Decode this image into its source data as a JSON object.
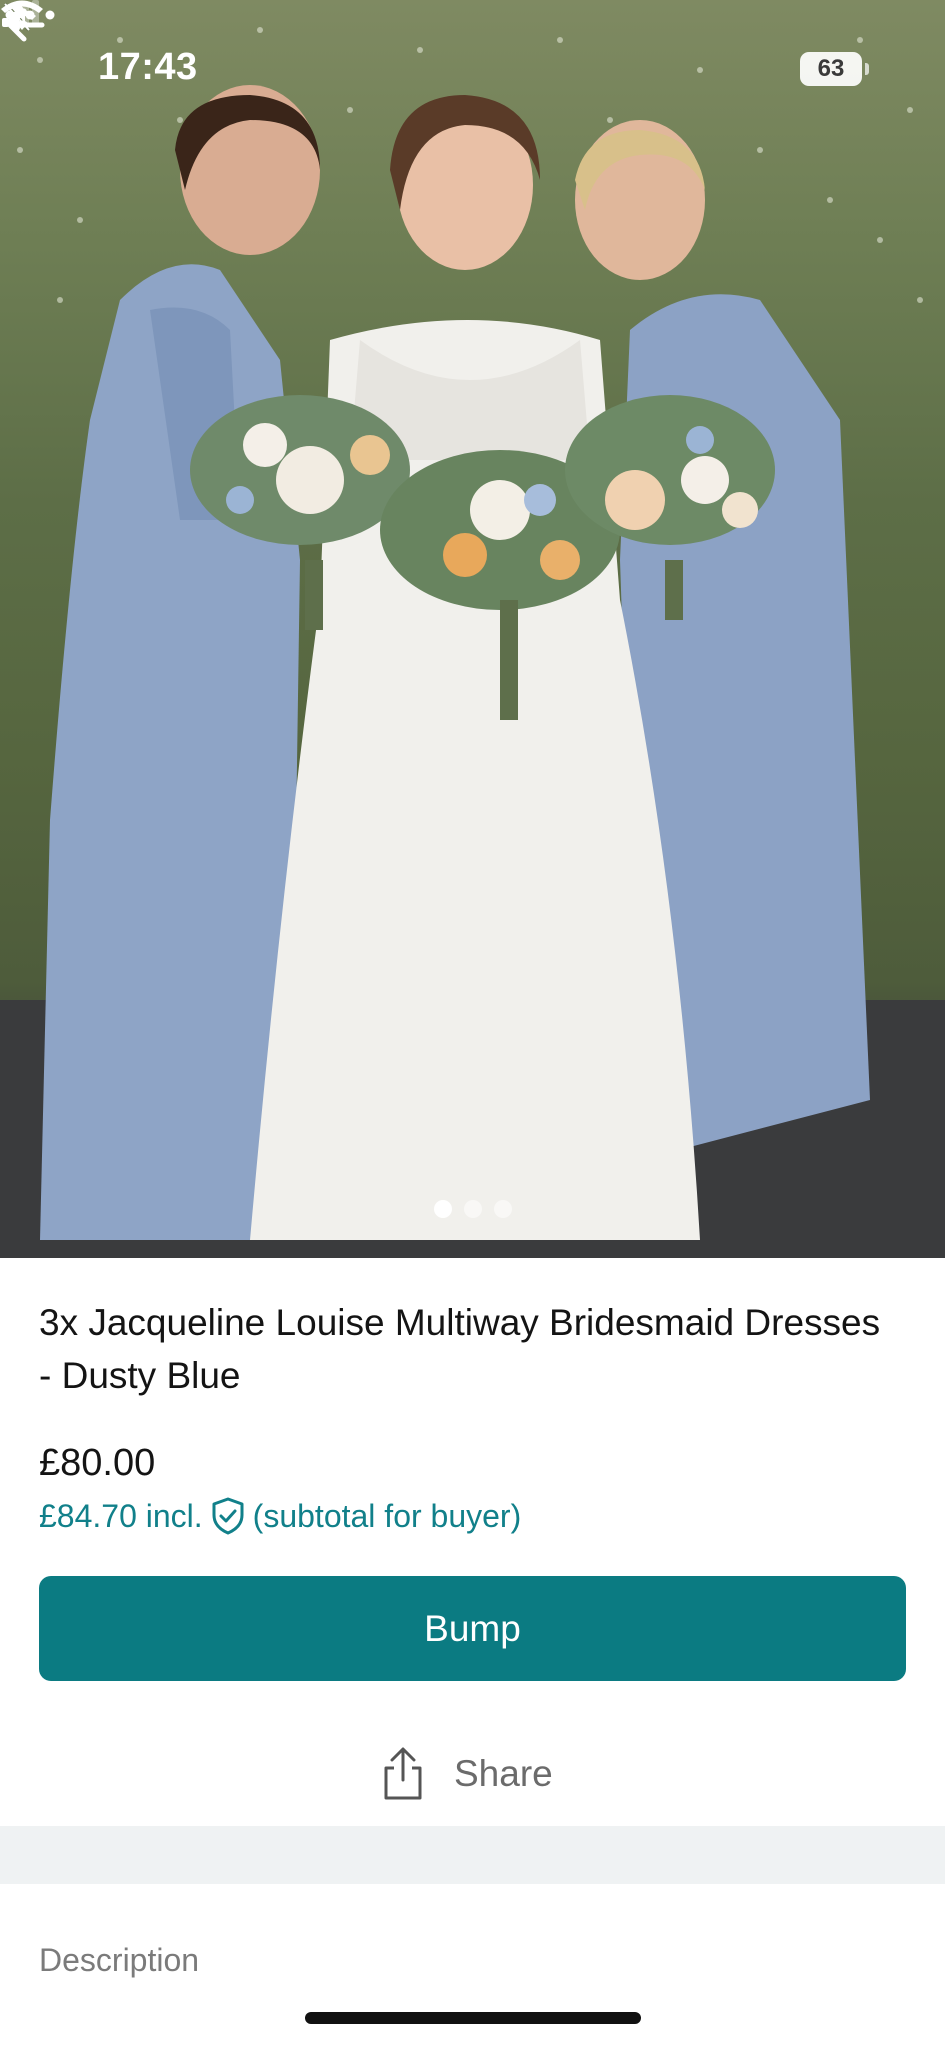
{
  "status_bar": {
    "time": "17:43",
    "battery": "63"
  },
  "listing": {
    "title": "3x Jacqueline Louise Multiway Bridesmaid Dresses - Dusty Blue",
    "price": "£80.00",
    "buyer_price": "£84.70 incl.",
    "buyer_price_note": "(subtotal for buyer)",
    "image_count": 3,
    "active_image": 1
  },
  "actions": {
    "bump_label": "Bump",
    "share_label": "Share"
  },
  "sections": {
    "description_label": "Description"
  },
  "colors": {
    "accent": "#0b7b82",
    "buyer_price_text": "#11808a",
    "divider_band": "#eff2f3"
  },
  "icons": {
    "back": "arrow-left-icon",
    "more": "more-horizontal-icon",
    "buyer_protection": "shield-check-icon",
    "share": "share-icon",
    "silent": "bell-slash-icon",
    "signal": "signal-icon",
    "wifi": "wifi-icon"
  }
}
